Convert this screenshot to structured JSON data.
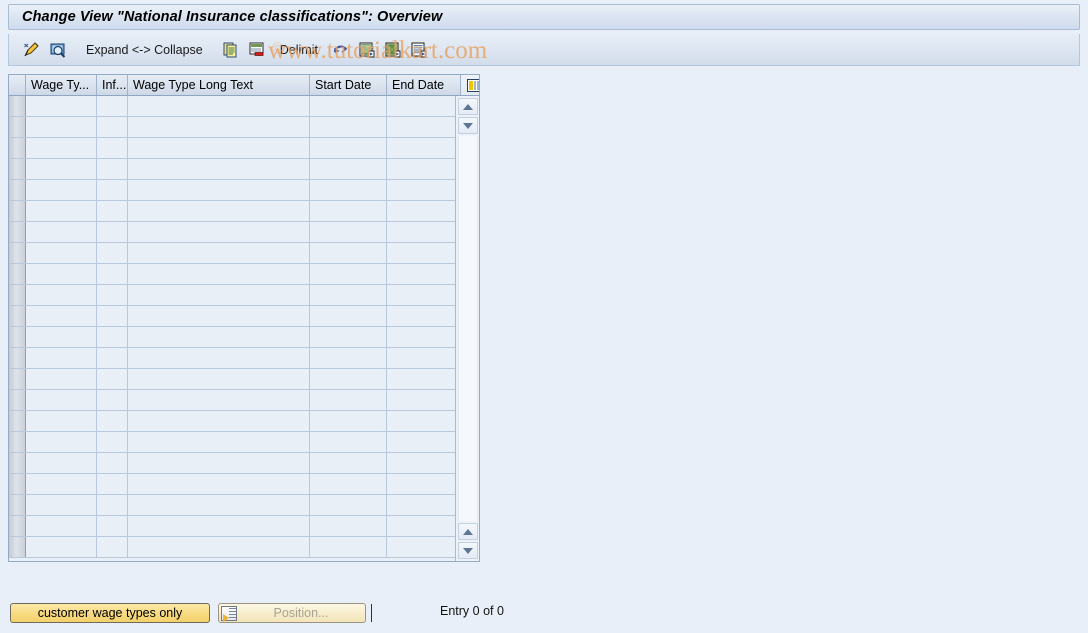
{
  "window": {
    "title": "Change View \"National Insurance classifications\": Overview"
  },
  "watermark": {
    "text": "www.tutorialkart.com",
    "mark": "©",
    "color": "#e8a466"
  },
  "toolbar": {
    "items": [
      {
        "name": "display-change-icon",
        "kind": "icon",
        "label": ""
      },
      {
        "name": "details-icon",
        "kind": "icon",
        "label": ""
      },
      {
        "name": "expand-collapse-label",
        "kind": "label",
        "label": "Expand <-> Collapse"
      },
      {
        "name": "copy-as-icon",
        "kind": "icon",
        "label": ""
      },
      {
        "name": "delete-icon",
        "kind": "icon",
        "label": ""
      },
      {
        "name": "delimit-label",
        "kind": "label",
        "label": "Delimit"
      },
      {
        "name": "undo-icon",
        "kind": "icon",
        "label": ""
      },
      {
        "name": "select-all-icon",
        "kind": "icon",
        "label": ""
      },
      {
        "name": "deselect-all-icon",
        "kind": "icon",
        "label": ""
      },
      {
        "name": "select-block-icon",
        "kind": "icon",
        "label": ""
      }
    ],
    "expand_collapse_label": "Expand <-> Collapse",
    "delimit_label": "Delimit"
  },
  "table": {
    "columns": [
      {
        "key": "sel",
        "label": ""
      },
      {
        "key": "wage",
        "label": "Wage Ty..."
      },
      {
        "key": "inf",
        "label": "Inf..."
      },
      {
        "key": "long",
        "label": "Wage Type Long Text"
      },
      {
        "key": "start",
        "label": "Start Date"
      },
      {
        "key": "end",
        "label": "End Date"
      }
    ],
    "rows": [],
    "empty_row_count": 22,
    "config_icon": "table-settings-icon"
  },
  "scrollbar": {
    "up_top": "scroll-up-icon",
    "down_top": "scroll-down-icon",
    "up_bottom": "scroll-page-up-icon",
    "down_bottom": "scroll-page-down-icon"
  },
  "footer": {
    "customer_wage_types_button": "customer wage types only",
    "position_button": "Position...",
    "position_icon": "position-to-row-icon",
    "entry_status": "Entry 0 of 0"
  },
  "colors": {
    "background": "#e9eff8",
    "title_bar": "#dde6f2",
    "grid_cell": "#e9eff7",
    "accent_yellow": "#f8dc86",
    "watermark": "#e8a466"
  }
}
